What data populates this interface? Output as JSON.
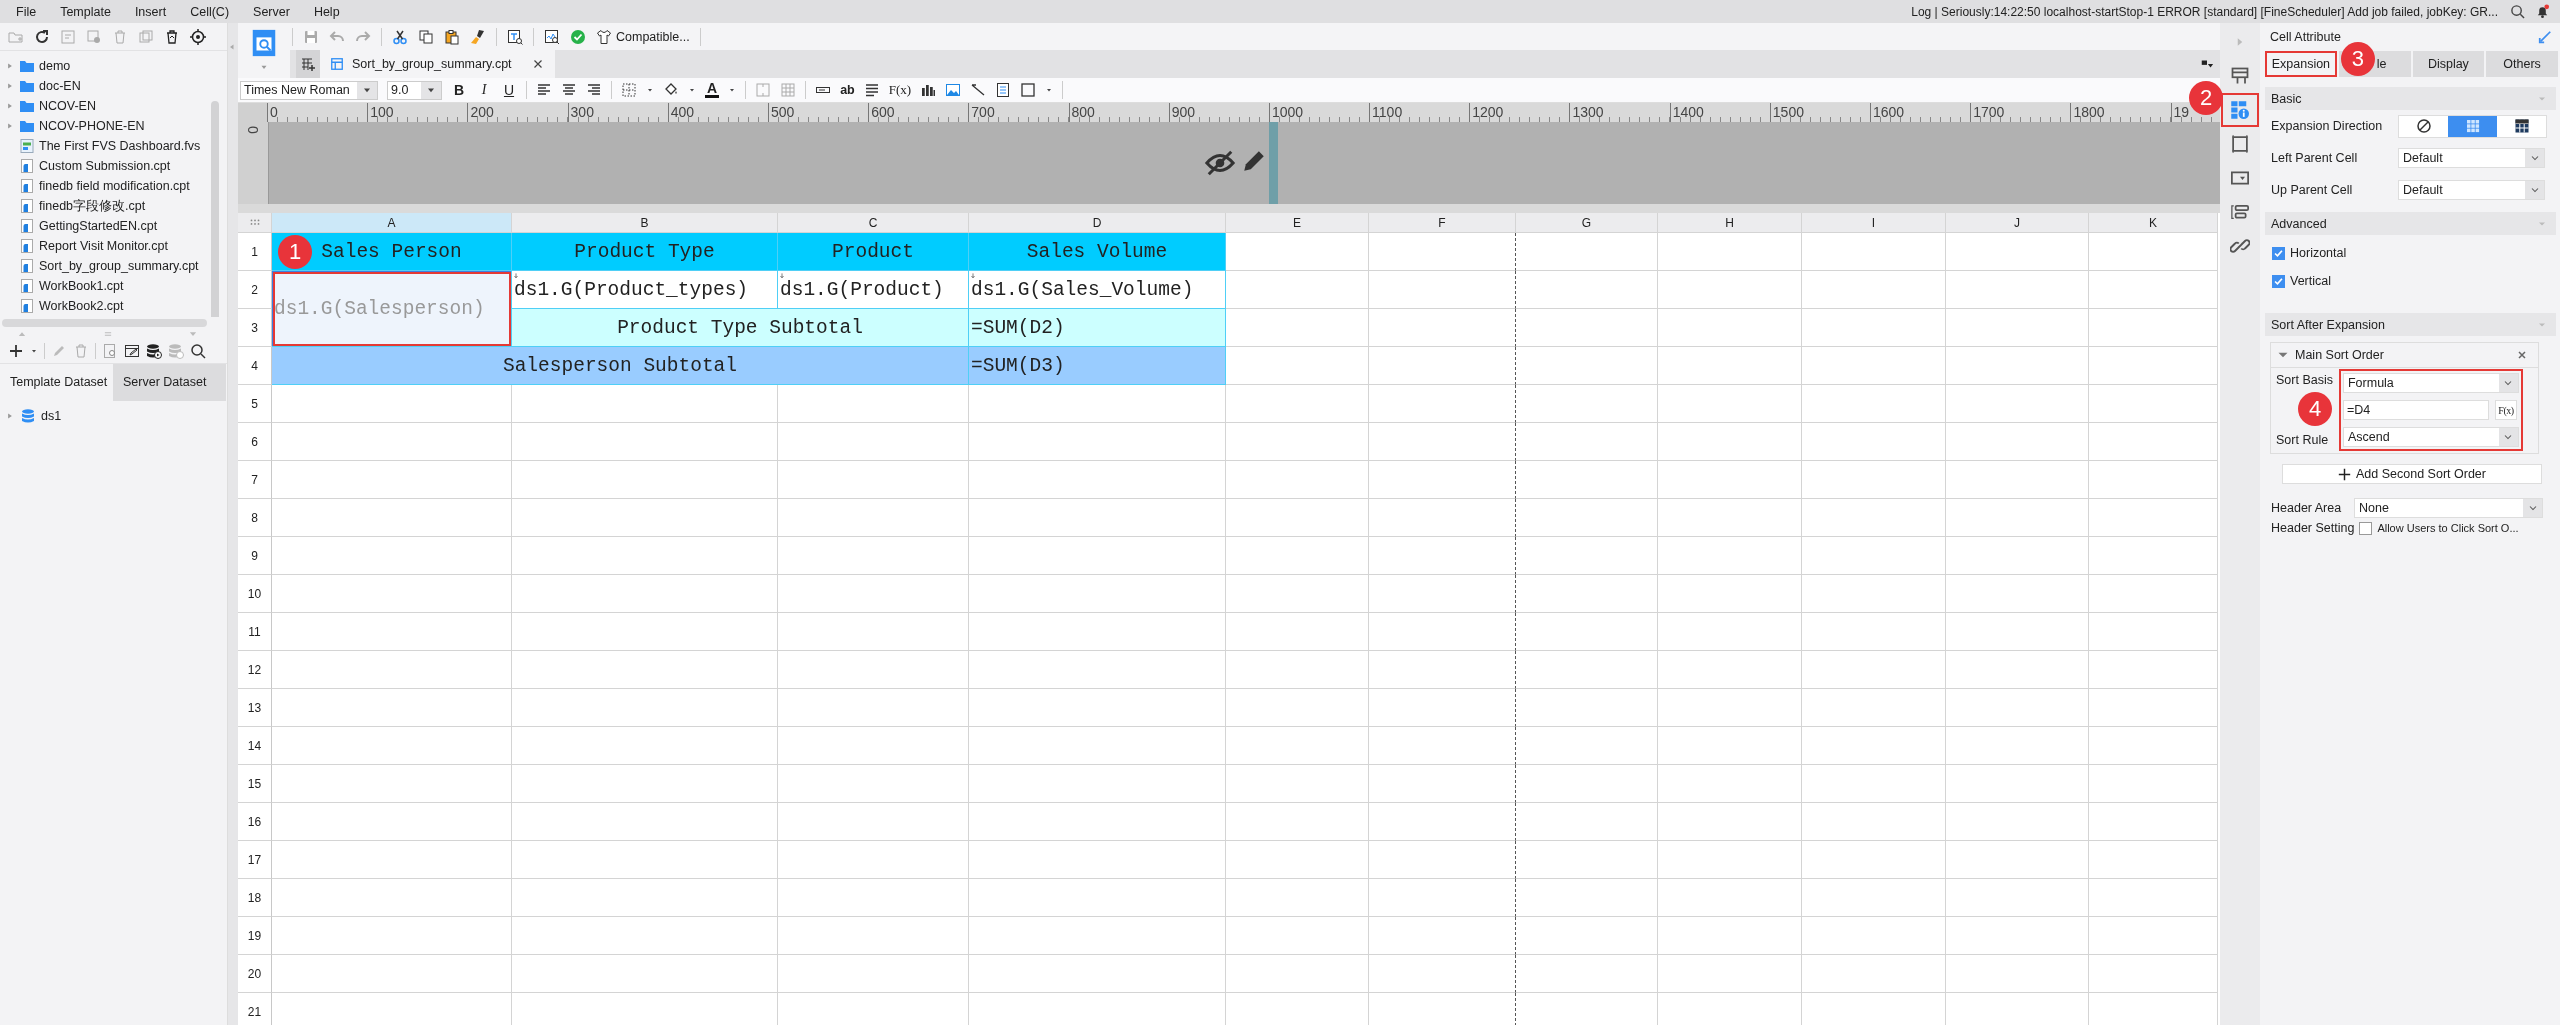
{
  "menu": [
    {
      "label": "File"
    },
    {
      "label": "Template"
    },
    {
      "label": "Insert"
    },
    {
      "label": "Cell(C)"
    },
    {
      "label": "Server"
    },
    {
      "label": "Help"
    }
  ],
  "log_message": "Log | Seriously:14:22:50 localhost-startStop-1 ERROR [standard] [FineScheduler] Add job failed, jobKey: GR...",
  "file_tree": [
    {
      "label": "demo",
      "kind": "folder"
    },
    {
      "label": "doc-EN",
      "kind": "folder"
    },
    {
      "label": "NCOV-EN",
      "kind": "folder"
    },
    {
      "label": "NCOV-PHONE-EN",
      "kind": "folder"
    },
    {
      "label": "The First FVS Dashboard.fvs",
      "kind": "dashboard"
    },
    {
      "label": "Custom Submission.cpt",
      "kind": "report"
    },
    {
      "label": "finedb field modification.cpt",
      "kind": "report"
    },
    {
      "label": "finedb字段修改.cpt",
      "kind": "report"
    },
    {
      "label": "GettingStartedEN.cpt",
      "kind": "report"
    },
    {
      "label": "Report Visit Monitor.cpt",
      "kind": "report"
    },
    {
      "label": "Sort_by_group_summary.cpt",
      "kind": "report"
    },
    {
      "label": "WorkBook1.cpt",
      "kind": "report"
    },
    {
      "label": "WorkBook2.cpt",
      "kind": "report"
    }
  ],
  "dataset_tabs": [
    {
      "label": "Template Dataset",
      "selected": true
    },
    {
      "label": "Server Dataset",
      "selected": false
    }
  ],
  "datasets": [
    {
      "label": "ds1"
    }
  ],
  "toolbar": {
    "compatibility": "Compatible..."
  },
  "document_tabs": [
    {
      "label": "Sort_by_group_summary.cpt",
      "selected": true
    }
  ],
  "format_bar": {
    "font": "Times New Roman",
    "font_size": "9.0",
    "bold": "B",
    "italic": "I",
    "underline": "U",
    "font_color": "A",
    "text_widget": "ab",
    "formula": "F(x)"
  },
  "ruler": {
    "marks": [
      "0",
      "100",
      "200",
      "300",
      "400",
      "500",
      "600",
      "700",
      "800",
      "900",
      "1000",
      "1100",
      "1200",
      "1300",
      "1400",
      "1500",
      "1600",
      "1700",
      "1800",
      "19"
    ],
    "vertical_mark": "0"
  },
  "sheet": {
    "columns": [
      {
        "label": "A",
        "selected": true,
        "page_break": false
      },
      {
        "label": "B",
        "selected": false,
        "page_break": false
      },
      {
        "label": "C",
        "selected": false,
        "page_break": false
      },
      {
        "label": "D",
        "selected": false,
        "page_break": false
      },
      {
        "label": "E",
        "selected": false,
        "page_break": false
      },
      {
        "label": "F",
        "selected": false,
        "page_break": true
      },
      {
        "label": "G",
        "selected": false,
        "page_break": false
      },
      {
        "label": "H",
        "selected": false,
        "page_break": false
      },
      {
        "label": "I",
        "selected": false,
        "page_break": false
      },
      {
        "label": "J",
        "selected": false,
        "page_break": false
      },
      {
        "label": "K",
        "selected": false,
        "page_break": false
      }
    ],
    "rows": [
      {
        "label": "1",
        "cells": [
          {
            "text": "Sales Person",
            "kind": "header",
            "centered": true,
            "selected": false,
            "highlighted": false,
            "expand_down": false
          },
          {
            "text": "Product Type",
            "kind": "header",
            "centered": true,
            "selected": false,
            "highlighted": false,
            "expand_down": false
          },
          {
            "text": "Product",
            "kind": "header",
            "centered": true,
            "selected": false,
            "highlighted": false,
            "expand_down": false
          },
          {
            "text": "Sales Volume",
            "kind": "header",
            "centered": true,
            "selected": false,
            "highlighted": false,
            "expand_down": false
          }
        ]
      },
      {
        "label": "2",
        "cells": [
          {
            "text": "ds1.G(Salesperson)",
            "kind": "group",
            "centered": false,
            "selected": true,
            "highlighted": true,
            "expand_down": false,
            "badge": "1"
          },
          {
            "text": "ds1.G(Product_types)",
            "kind": "field",
            "centered": false,
            "selected": false,
            "highlighted": false,
            "expand_down": true
          },
          {
            "text": "ds1.G(Product)",
            "kind": "field",
            "centered": false,
            "selected": false,
            "highlighted": false,
            "expand_down": true
          },
          {
            "text": "ds1.G(Sales_Volume)",
            "kind": "field",
            "centered": false,
            "selected": false,
            "highlighted": false,
            "expand_down": true
          }
        ]
      },
      {
        "label": "3",
        "cells": [
          {
            "text": "Product Type Subtotal",
            "kind": "subtotal_label",
            "centered": true,
            "selected": false,
            "highlighted": false,
            "expand_down": false
          },
          {
            "text": "=SUM(D2)",
            "kind": "subtotal",
            "centered": false,
            "selected": false,
            "highlighted": false,
            "expand_down": false
          }
        ]
      },
      {
        "label": "4",
        "cells": [
          {
            "text": "Salesperson Subtotal",
            "kind": "total_label",
            "centered": true,
            "selected": false,
            "highlighted": false,
            "expand_down": false
          },
          {
            "text": "=SUM(D3)",
            "kind": "total",
            "centered": false,
            "selected": false,
            "highlighted": false,
            "expand_down": false
          }
        ]
      },
      {
        "label": "5"
      },
      {
        "label": "6"
      },
      {
        "label": "7"
      },
      {
        "label": "8"
      },
      {
        "label": "9"
      },
      {
        "label": "10"
      },
      {
        "label": "11"
      },
      {
        "label": "12"
      },
      {
        "label": "13"
      },
      {
        "label": "14"
      },
      {
        "label": "15"
      },
      {
        "label": "16"
      },
      {
        "label": "17"
      },
      {
        "label": "18"
      },
      {
        "label": "19"
      },
      {
        "label": "20"
      },
      {
        "label": "21"
      }
    ]
  },
  "side_bar": [
    {
      "kind": "frame",
      "selected": false,
      "highlighted": false
    },
    {
      "kind": "cell-info",
      "selected": true,
      "highlighted": true,
      "badge": "2"
    },
    {
      "kind": "square",
      "selected": false,
      "highlighted": false
    },
    {
      "kind": "widget",
      "selected": false,
      "highlighted": false
    },
    {
      "kind": "condition",
      "selected": false,
      "highlighted": false
    },
    {
      "kind": "link",
      "selected": false,
      "highlighted": false
    }
  ],
  "cell_attribute": {
    "title": "Cell Attribute",
    "tabs": [
      {
        "label": "Expansion",
        "selected": true,
        "highlighted": true,
        "badge": "3"
      },
      {
        "label": "le",
        "selected": false,
        "highlighted": false
      },
      {
        "label": "Display",
        "selected": false,
        "highlighted": false
      },
      {
        "label": "Others",
        "selected": false,
        "highlighted": false
      }
    ],
    "basic": {
      "title": "Basic",
      "expansion_direction": {
        "label": "Expansion Direction",
        "options": [
          {
            "kind": "none",
            "selected": false
          },
          {
            "kind": "vertical",
            "selected": true
          },
          {
            "kind": "horizontal",
            "selected": false
          }
        ]
      },
      "left_parent": {
        "label": "Left Parent Cell",
        "value": "Default"
      },
      "up_parent": {
        "label": "Up Parent Cell",
        "value": "Default"
      }
    },
    "advanced": {
      "title": "Advanced",
      "options": [
        {
          "label": "Horizontal",
          "checked": true
        },
        {
          "label": "Vertical",
          "checked": true
        }
      ]
    },
    "sort": {
      "title": "Sort After Expansion",
      "main_order": {
        "title": "Main Sort Order",
        "basis_label": "Sort Basis",
        "basis": "Formula",
        "formula": "=D4",
        "formula_button": "F(x)",
        "rule_label": "Sort Rule",
        "rule": "Ascend",
        "highlighted": true,
        "badge": "4"
      },
      "add_button": "Add Second Sort Order",
      "header_area": {
        "label": "Header Area",
        "value": "None"
      },
      "header_setting": {
        "label": "Header Setting",
        "option": "Allow Users to Click Sort O...",
        "checked": false
      }
    }
  }
}
